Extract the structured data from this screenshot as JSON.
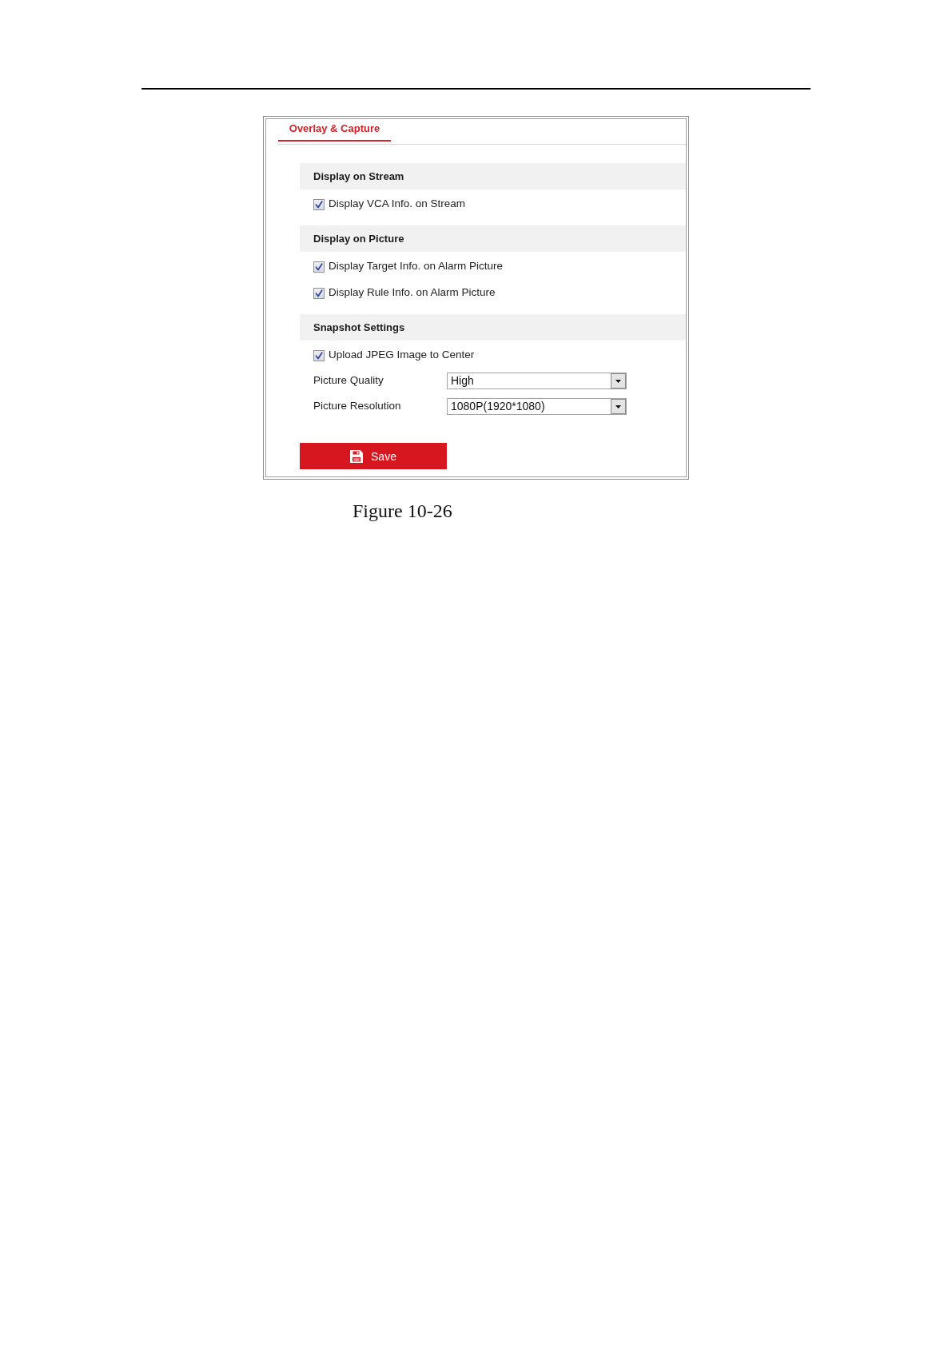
{
  "tabs": [
    {
      "label": "Overlay & Capture",
      "selected": true
    }
  ],
  "sections": [
    {
      "title": "Display on Stream",
      "items": [
        {
          "kind": "checkbox",
          "label": "Display VCA Info. on Stream",
          "checked": true
        }
      ]
    },
    {
      "title": "Display on Picture",
      "items": [
        {
          "kind": "checkbox",
          "label": "Display Target Info. on Alarm Picture",
          "checked": true
        },
        {
          "kind": "checkbox",
          "label": "Display Rule Info. on Alarm Picture",
          "checked": true
        }
      ]
    },
    {
      "title": "Snapshot Settings",
      "items": [
        {
          "kind": "checkbox",
          "label": "Upload JPEG Image to Center",
          "checked": true
        },
        {
          "kind": "select",
          "label": "Picture Quality",
          "value": "High"
        },
        {
          "kind": "select",
          "label": "Picture Resolution",
          "value": "1080P(1920*1080)"
        }
      ]
    }
  ],
  "save_button": "Save",
  "caption": "Figure 10-26"
}
